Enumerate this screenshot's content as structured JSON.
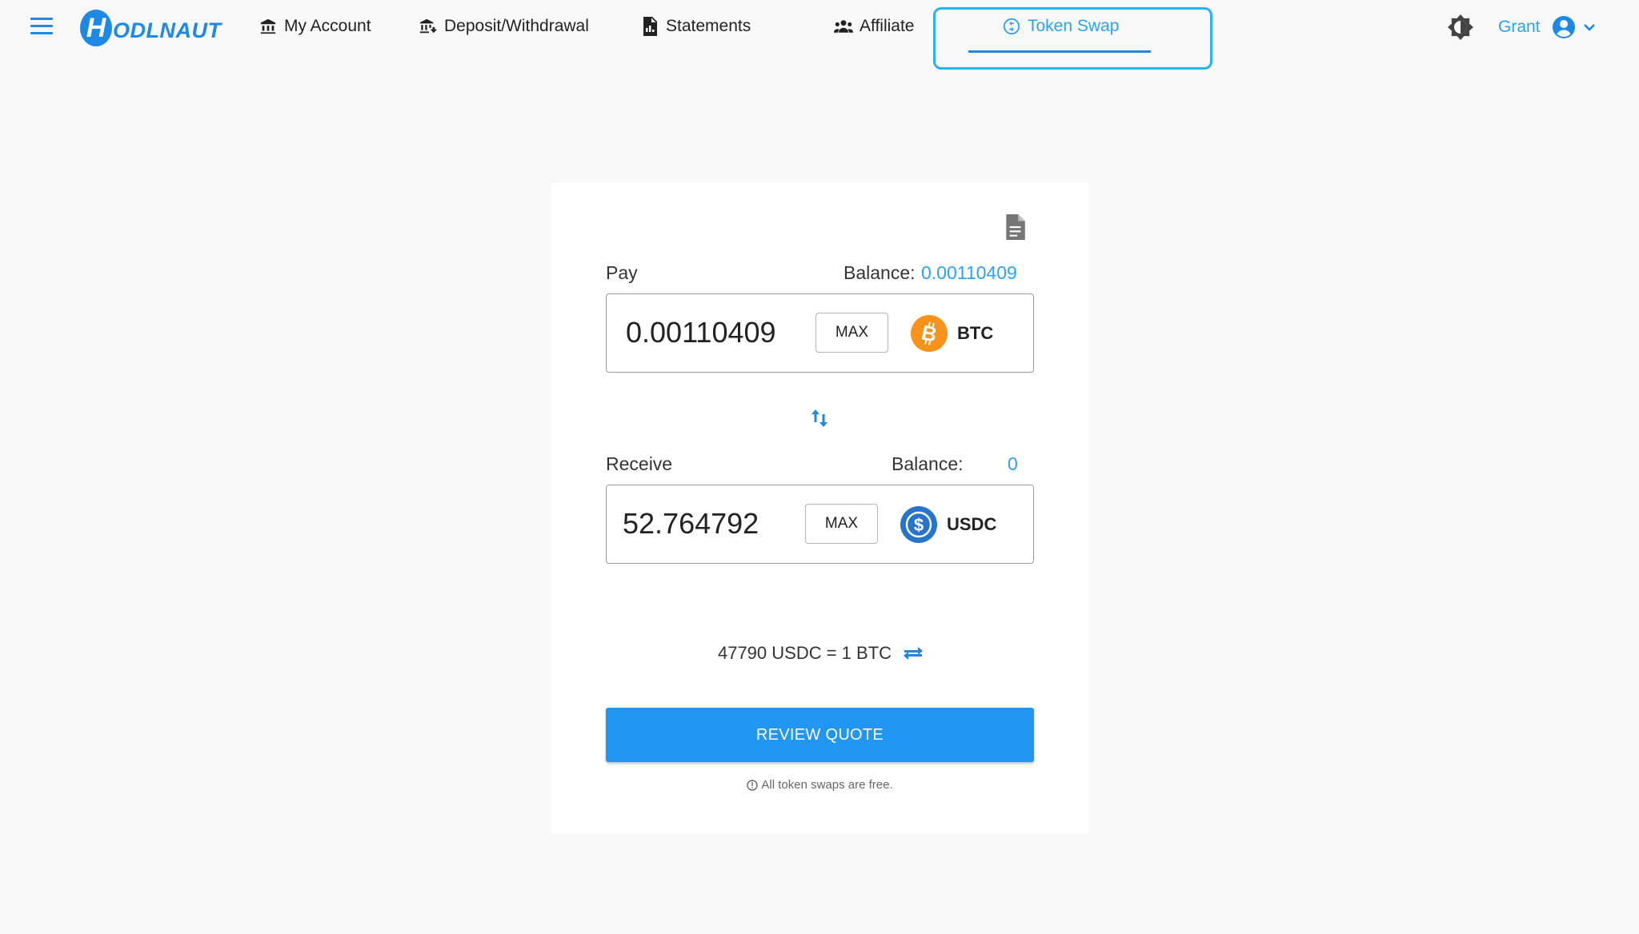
{
  "header": {
    "logo_text": "ODLNAUT",
    "logo_letter": "H",
    "nav": [
      {
        "label": "My Account",
        "icon": "bank-icon"
      },
      {
        "label": "Deposit/Withdrawal",
        "icon": "deposit-icon"
      },
      {
        "label": "Statements",
        "icon": "statement-icon"
      },
      {
        "label": "Affiliate",
        "icon": "people-icon"
      },
      {
        "label": "Token Swap",
        "icon": "token-swap-icon",
        "active": true
      }
    ],
    "user_name": "Grant"
  },
  "swap": {
    "pay": {
      "label": "Pay",
      "balance_label": "Balance:",
      "balance_value": "0.00110409",
      "amount": "0.00110409",
      "max_label": "MAX",
      "token": "BTC"
    },
    "receive": {
      "label": "Receive",
      "balance_label": "Balance:",
      "balance_value": "0",
      "amount": "52.764792",
      "max_label": "MAX",
      "token": "USDC"
    },
    "rate_text": "47790 USDC = 1 BTC",
    "review_label": "REVIEW QUOTE",
    "note": "All token swaps are free."
  },
  "colors": {
    "accent": "#2196f3",
    "link": "#29a3f5",
    "btc": "#f7931a",
    "usdc": "#2775ca",
    "active_frame": "#29b3ea"
  }
}
